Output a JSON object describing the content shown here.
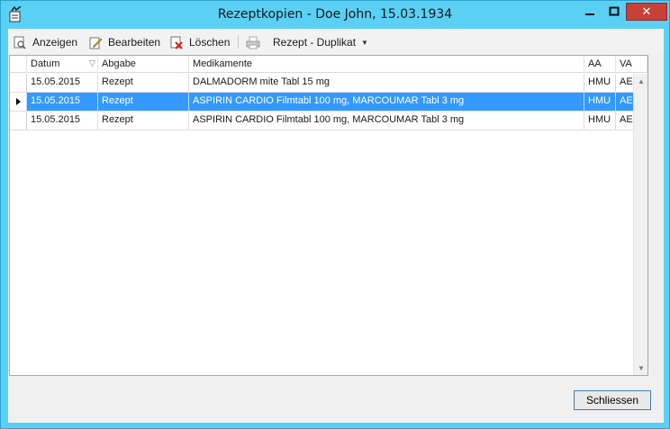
{
  "window": {
    "title": "Rezeptkopien - Doe John, 15.03.1934",
    "accent_color": "#5ad0f4",
    "close_color": "#c7403a"
  },
  "toolbar": {
    "show_label": "Anzeigen",
    "edit_label": "Bearbeiten",
    "delete_label": "Löschen",
    "duplicate_label": "Rezept - Duplikat"
  },
  "grid": {
    "columns": [
      "Datum",
      "Abgabe",
      "Medikamente",
      "AA",
      "VA"
    ],
    "rows": [
      {
        "datum": "15.05.2015",
        "abgabe": "Rezept",
        "medikamente": "DALMADORM mite Tabl 15 mg",
        "aa": "HMU",
        "va": "AE"
      },
      {
        "datum": "15.05.2015",
        "abgabe": "Rezept",
        "medikamente": "ASPIRIN CARDIO Filmtabl 100 mg, MARCOUMAR Tabl 3 mg",
        "aa": "HMU",
        "va": "AE"
      },
      {
        "datum": "15.05.2015",
        "abgabe": "Rezept",
        "medikamente": "ASPIRIN CARDIO Filmtabl 100 mg, MARCOUMAR Tabl 3 mg",
        "aa": "HMU",
        "va": "AE"
      }
    ],
    "selection_color": "#3399ff"
  },
  "footer": {
    "close_button_label": "Schliessen"
  }
}
